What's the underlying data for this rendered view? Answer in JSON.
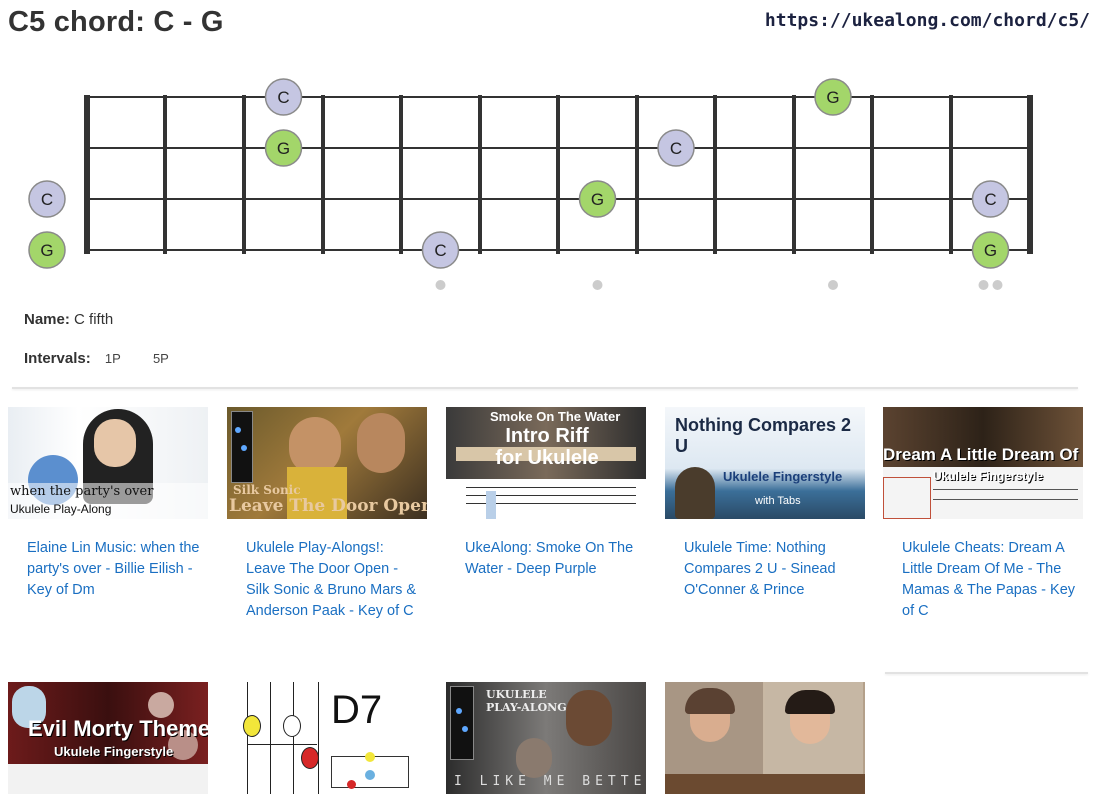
{
  "page": {
    "title": "C5 chord: C - G",
    "url": "https://ukealong.com/chord/c5/"
  },
  "fretboard": {
    "strings": 4,
    "frets": 12,
    "inlay_frets": [
      5,
      7,
      10,
      12
    ],
    "notes": [
      {
        "string": 1,
        "fret": 3,
        "label": "C",
        "role": "root"
      },
      {
        "string": 2,
        "fret": 3,
        "label": "G",
        "role": "fifth"
      },
      {
        "string": 3,
        "fret": 0,
        "label": "C",
        "role": "root"
      },
      {
        "string": 4,
        "fret": 0,
        "label": "G",
        "role": "fifth"
      },
      {
        "string": 4,
        "fret": 5,
        "label": "C",
        "role": "root"
      },
      {
        "string": 3,
        "fret": 7,
        "label": "G",
        "role": "fifth"
      },
      {
        "string": 2,
        "fret": 8,
        "label": "C",
        "role": "root"
      },
      {
        "string": 1,
        "fret": 10,
        "label": "G",
        "role": "fifth"
      },
      {
        "string": 3,
        "fret": 12,
        "label": "C",
        "role": "root"
      },
      {
        "string": 4,
        "fret": 12,
        "label": "G",
        "role": "fifth"
      }
    ],
    "colors": {
      "root": "#c5c6e2",
      "fifth": "#a3d66a",
      "line": "#333333",
      "inlay": "#cccccc"
    }
  },
  "info": {
    "name_label": "Name:",
    "name_value": "C fifth",
    "intervals_label": "Intervals:",
    "intervals": [
      "1P",
      "5P"
    ]
  },
  "videos": [
    {
      "thumb_text": "when the party's over",
      "thumb_sub": "Ukulele Play-Along",
      "caption": "Elaine Lin Music: when the party's over - Billie Eilish - Key of Dm"
    },
    {
      "thumb_text": "Leave The Door Open",
      "thumb_sub": "Silk Sonic",
      "caption": "Ukulele Play-Alongs!: Leave The Door Open - Silk Sonic & Bruno Mars & Anderson Paak - Key of C"
    },
    {
      "thumb_text": "Intro Riff for Ukulele",
      "thumb_sub": "Smoke On The Water",
      "caption": "UkeAlong: Smoke On The Water - Deep Purple"
    },
    {
      "thumb_text": "Nothing Compares 2 U",
      "thumb_sub": "Ukulele Fingerstyle",
      "thumb_sub2": "with Tabs",
      "caption": "Ukulele Time: Nothing Compares 2 U - Sinead O'Conner & Prince"
    },
    {
      "thumb_text": "Dream A Little Dream Of Me",
      "thumb_sub": "Ukulele Fingerstyle",
      "caption": "Ukulele Cheats: Dream A Little Dream Of Me - The Mamas & The Papas - Key of C"
    },
    {
      "thumb_text": "Evil Morty Theme",
      "thumb_sub": "Ukulele Fingerstyle",
      "caption": ""
    },
    {
      "thumb_text": "D7",
      "thumb_sub": "",
      "caption": ""
    },
    {
      "thumb_text": "I LIKE ME BETTER",
      "thumb_sub": "UKULELE PLAY-ALONG",
      "caption": ""
    },
    {
      "thumb_text": "",
      "thumb_sub": "",
      "caption": ""
    }
  ]
}
